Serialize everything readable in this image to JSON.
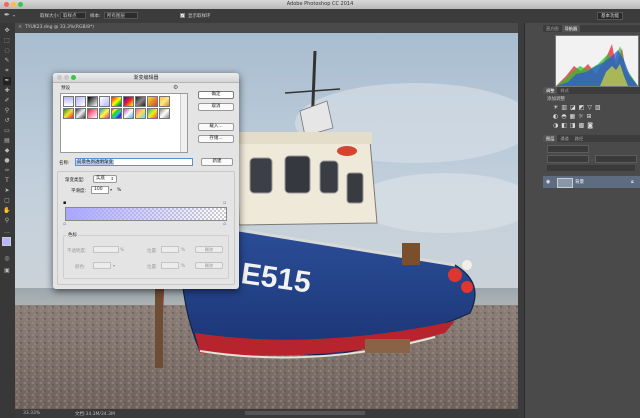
{
  "app": {
    "title": "Adobe Photoshop CC 2014"
  },
  "options_bar": {
    "sample_size_label": "取样大小:",
    "sample_size_value": "取样点",
    "sample_label": "样本:",
    "sample_value": "所有图层",
    "show_ring_label": "显示取样环",
    "workspace": "基本功能"
  },
  "document": {
    "tab_label": "TYUK23.dng @ 33.3%(RGB/8*)",
    "zoom": "33.33%",
    "doc_size": "文档:34.3M/34.3M",
    "boat_number": "E515"
  },
  "panels": {
    "top_tabs": [
      "直方图",
      "导航器"
    ],
    "adjust_tabs": [
      "调整",
      "样式"
    ],
    "adjust_title": "添加调整",
    "layer_tabs": [
      "图层",
      "通道",
      "路径"
    ],
    "layer_name": "背景"
  },
  "dialog": {
    "title": "渐变编辑器",
    "presets_label": "预设",
    "ok": "确定",
    "cancel": "取消",
    "load": "载入...",
    "save": "存储...",
    "name_label": "名称:",
    "name_value": "前景色到透明渐变",
    "new_button": "新建",
    "gradient_type_label": "渐变类型:",
    "gradient_type_value": "实底",
    "smoothness_label": "平滑度:",
    "smoothness_value": "100",
    "smoothness_unit": "%",
    "stops_label": "色标",
    "opacity_label": "不透明度:",
    "location_label": "位置:",
    "percent": "%",
    "delete_label": "删除",
    "color_label": "颜色:"
  }
}
